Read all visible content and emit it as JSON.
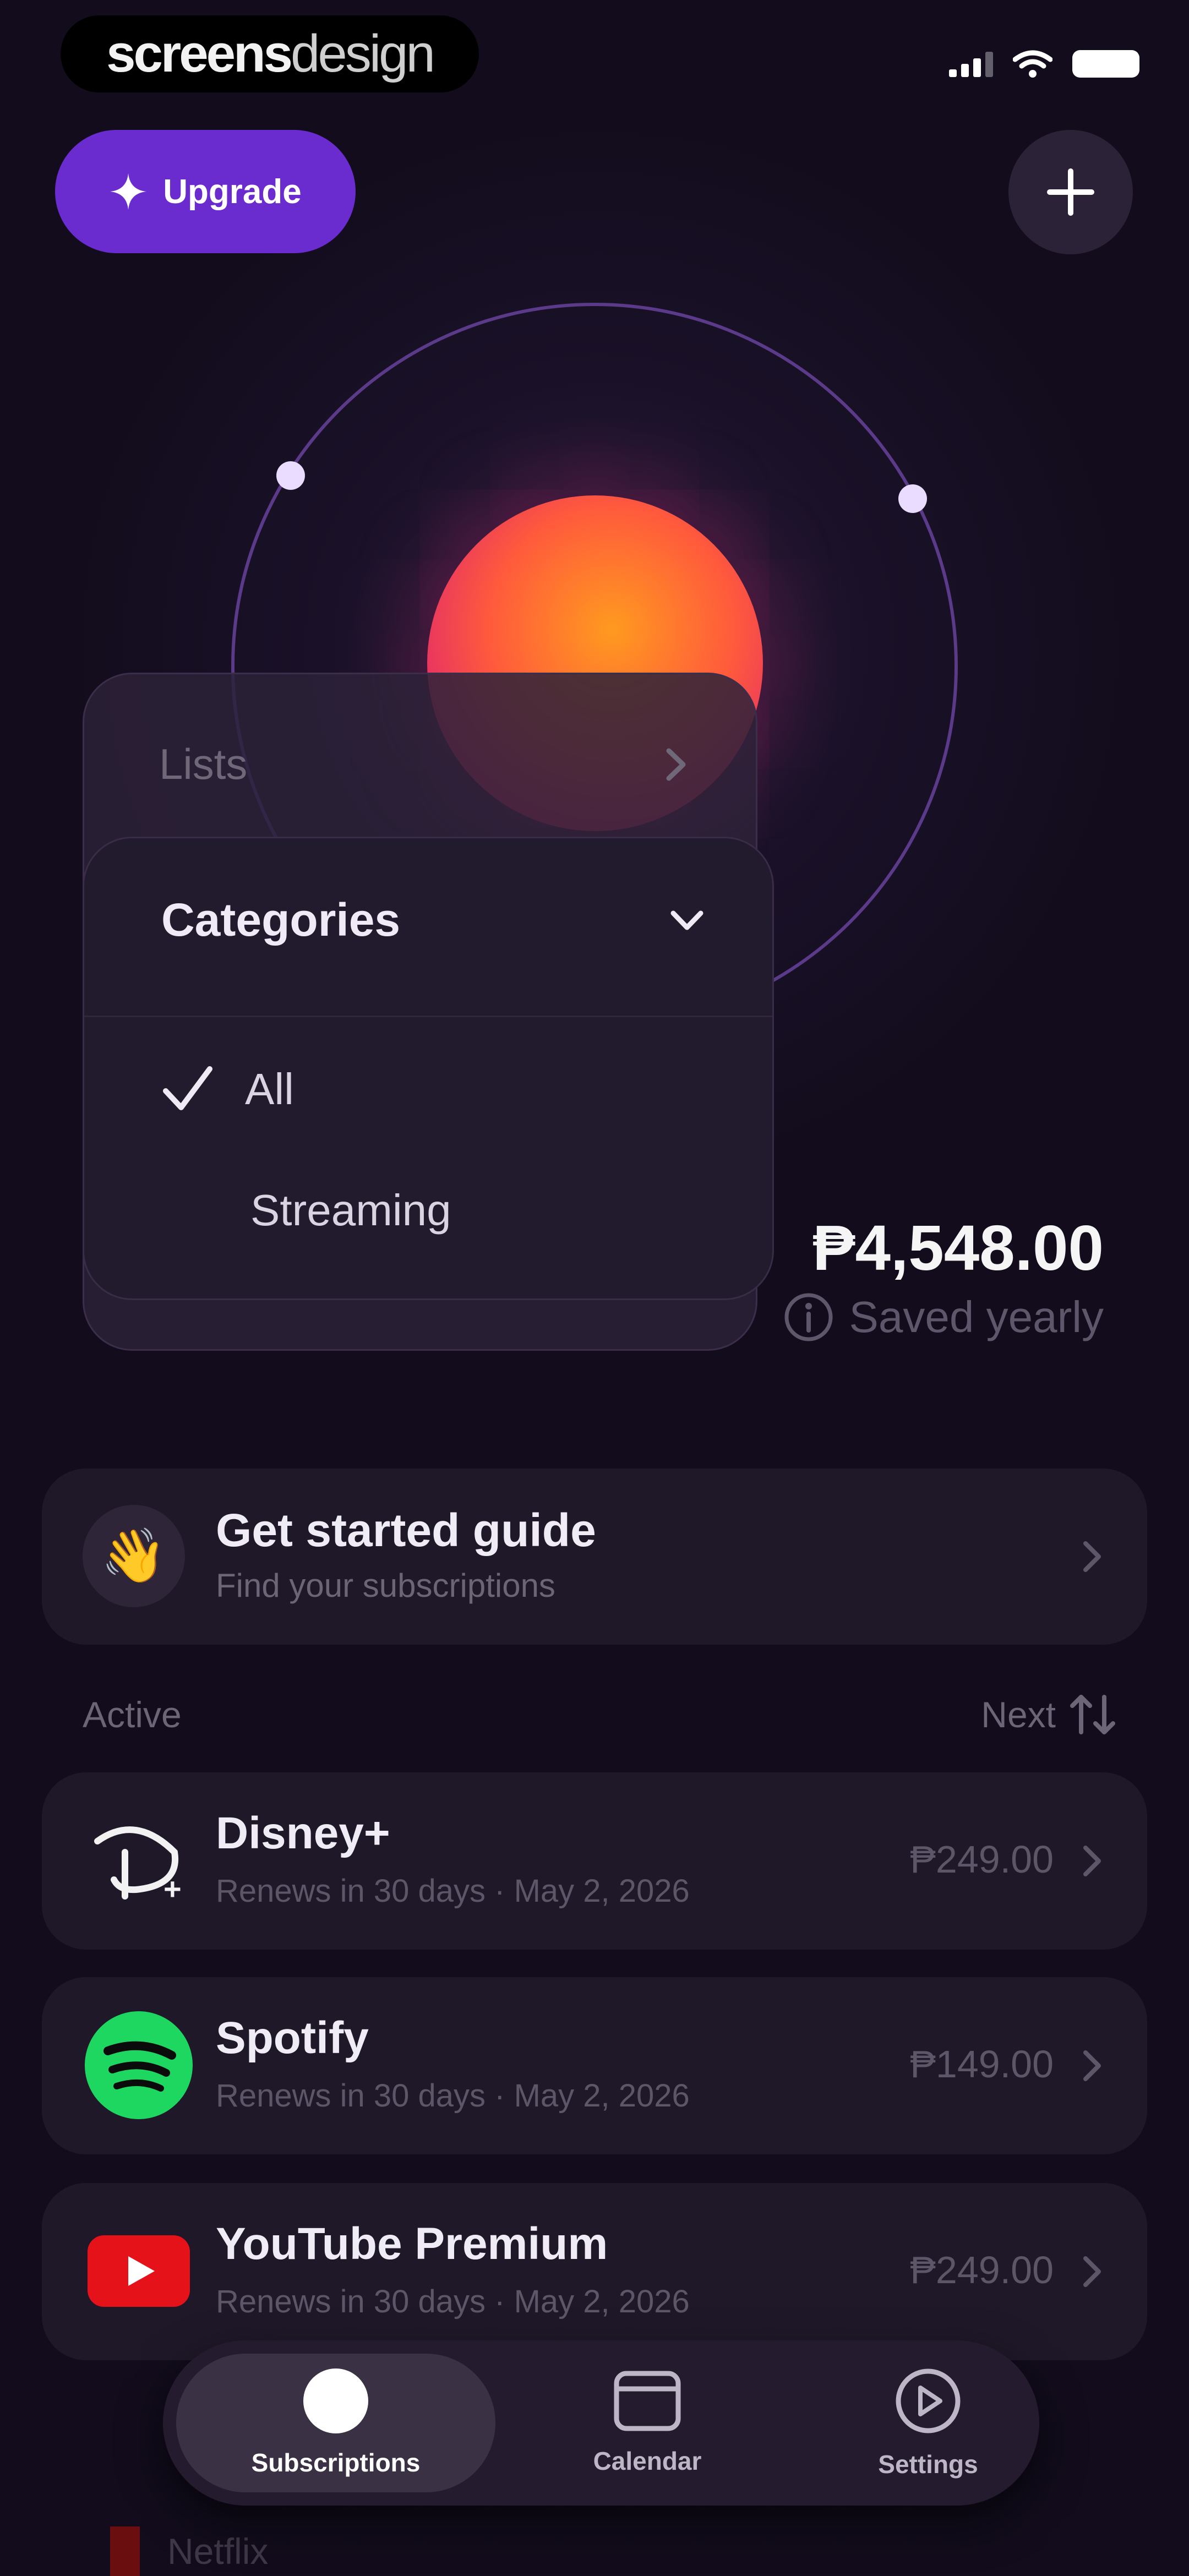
{
  "status_bar": {
    "brand_bold": "screens",
    "brand_light": "design"
  },
  "header": {
    "upgrade_label": "Upgrade",
    "add_icon": "plus-icon"
  },
  "menu": {
    "lists_label": "Lists",
    "categories_label": "Categories",
    "items": [
      {
        "label": "All",
        "selected": true
      },
      {
        "label": "Streaming",
        "selected": false
      }
    ]
  },
  "savings": {
    "amount": "₱4,548.00",
    "label": "Saved yearly"
  },
  "guide": {
    "emoji": "👋",
    "title": "Get started guide",
    "subtitle": "Find your subscriptions"
  },
  "section": {
    "title": "Active",
    "sort_label": "Next"
  },
  "subscriptions": [
    {
      "name": "Disney+",
      "meta": "Renews in 30 days · May 2, 2026",
      "price": "₱249.00",
      "icon": "disney-logo"
    },
    {
      "name": "Spotify",
      "meta": "Renews in 30 days · May 2, 2026",
      "price": "₱149.00",
      "icon": "spotify-logo"
    },
    {
      "name": "YouTube Premium",
      "meta": "Renews in 30 days · May 2, 2026",
      "price": "₱249.00",
      "icon": "youtube-logo"
    }
  ],
  "peek": {
    "next_label": "Netflix"
  },
  "tabs": [
    {
      "label": "Subscriptions",
      "icon": "subscriptions-icon",
      "active": true
    },
    {
      "label": "Calendar",
      "icon": "calendar-icon",
      "active": false
    },
    {
      "label": "Settings",
      "icon": "settings-icon",
      "active": false
    }
  ],
  "colors": {
    "accent": "#6a2ccf",
    "background": "#120c1c",
    "card": "#1f1829",
    "spotify_green": "#1ed760",
    "youtube_red": "#e5121a"
  }
}
